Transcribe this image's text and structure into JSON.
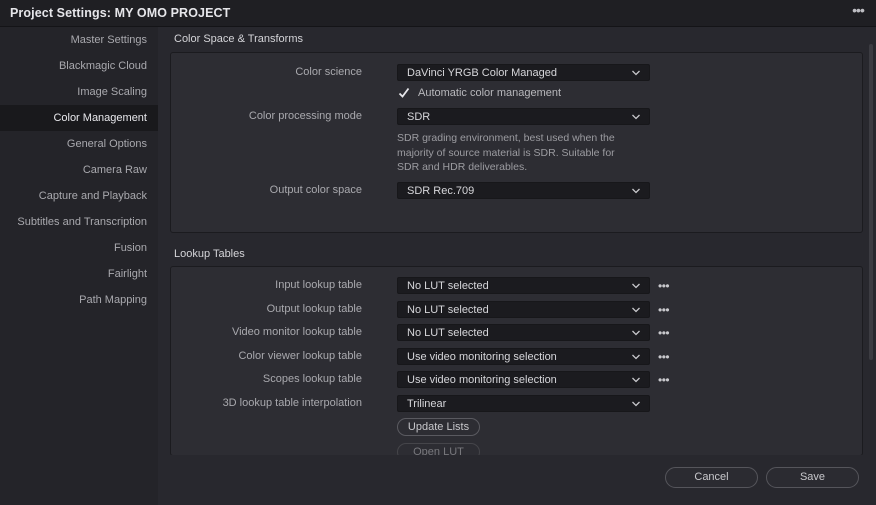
{
  "window": {
    "title": "Project Settings:  MY OMO PROJECT",
    "more_icon": "ellipsis-icon"
  },
  "sidebar": {
    "items": [
      {
        "label": "Master Settings",
        "active": false
      },
      {
        "label": "Blackmagic Cloud",
        "active": false
      },
      {
        "label": "Image Scaling",
        "active": false
      },
      {
        "label": "Color Management",
        "active": true
      },
      {
        "label": "General Options",
        "active": false
      },
      {
        "label": "Camera Raw",
        "active": false
      },
      {
        "label": "Capture and Playback",
        "active": false
      },
      {
        "label": "Subtitles and Transcription",
        "active": false
      },
      {
        "label": "Fusion",
        "active": false
      },
      {
        "label": "Fairlight",
        "active": false
      },
      {
        "label": "Path Mapping",
        "active": false
      }
    ]
  },
  "color_space": {
    "title": "Color Space & Transforms",
    "color_science_label": "Color science",
    "color_science_value": "DaVinci YRGB Color Managed",
    "auto_cm_label": "Automatic color management",
    "auto_cm_checked": true,
    "processing_mode_label": "Color processing mode",
    "processing_mode_value": "SDR",
    "processing_mode_desc": "SDR grading environment, best used when the majority of source material is SDR. Suitable for SDR and HDR deliverables.",
    "output_space_label": "Output color space",
    "output_space_value": "SDR Rec.709"
  },
  "lookup_tables": {
    "title": "Lookup Tables",
    "rows": [
      {
        "label": "Input lookup table",
        "value": "No LUT selected",
        "has_menu": true
      },
      {
        "label": "Output lookup table",
        "value": "No LUT selected",
        "has_menu": true
      },
      {
        "label": "Video monitor lookup table",
        "value": "No LUT selected",
        "has_menu": true
      },
      {
        "label": "Color viewer lookup table",
        "value": "Use video monitoring selection",
        "has_menu": true
      },
      {
        "label": "Scopes lookup table",
        "value": "Use video monitoring selection",
        "has_menu": true
      },
      {
        "label": "3D lookup table interpolation",
        "value": "Trilinear",
        "has_menu": false
      }
    ],
    "update_lists_label": "Update Lists",
    "open_lut_folder_label": "Open LUT Folder"
  },
  "footer": {
    "cancel_label": "Cancel",
    "save_label": "Save"
  },
  "colors": {
    "background": "#28282e",
    "panel": "#2d2d33",
    "dropdown": "#1b1b1f",
    "sidebar_active": "#19191c"
  }
}
